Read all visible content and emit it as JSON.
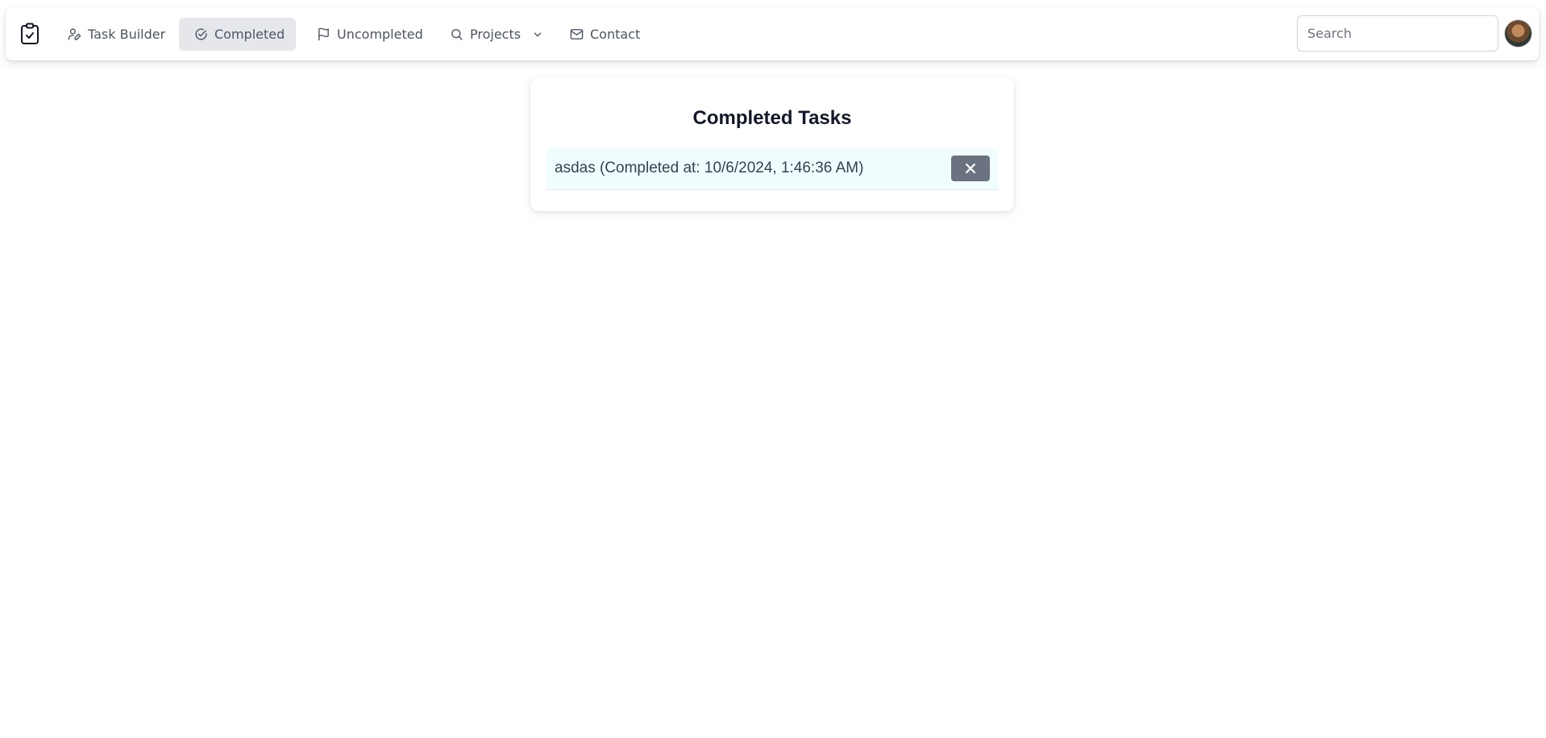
{
  "nav": {
    "items": [
      {
        "label": "Task Builder",
        "icon": "user-pen-icon",
        "active": false
      },
      {
        "label": "Completed",
        "icon": "check-circle-icon",
        "active": true
      },
      {
        "label": "Uncompleted",
        "icon": "flag-icon",
        "active": false
      },
      {
        "label": "Projects",
        "icon": "search-icon",
        "active": false,
        "dropdown": true
      },
      {
        "label": "Contact",
        "icon": "mail-icon",
        "active": false
      }
    ],
    "search_placeholder": "Search"
  },
  "main": {
    "title": "Completed Tasks",
    "tasks": [
      {
        "text": "asdas (Completed at: 10/6/2024, 1:46:36 AM)"
      }
    ]
  }
}
